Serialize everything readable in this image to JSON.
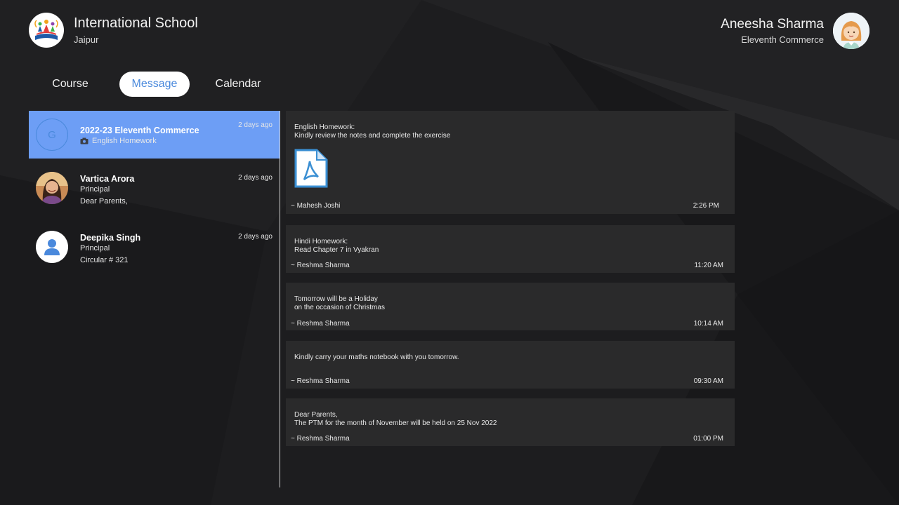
{
  "school": {
    "name": "International School",
    "city": "Jaipur",
    "logo_icon": "school-logo-icon"
  },
  "user": {
    "name": "Aneesha Sharma",
    "class": "Eleventh Commerce",
    "avatar_icon": "girl-avatar-icon"
  },
  "tabs": [
    {
      "label": "Course",
      "active": false
    },
    {
      "label": "Message",
      "active": true
    },
    {
      "label": "Calendar",
      "active": false
    }
  ],
  "conversations": [
    {
      "title": "2022-23 Eleventh Commerce",
      "line1": "English Homework",
      "line1_icon": "camera-icon",
      "time": "2 days ago",
      "avatar_letter": "G",
      "active": true
    },
    {
      "title": "Vartica Arora",
      "line1": "Principal",
      "line2": "Dear Parents,",
      "time": "2 days ago",
      "avatar_icon": "photo-avatar"
    },
    {
      "title": "Deepika Singh",
      "line1": "Principal",
      "line2": "Circular  # 321",
      "time": "2 days ago",
      "avatar_icon": "person-icon"
    }
  ],
  "messages": [
    {
      "text": "English Homework:\nKindly review the notes and complete the exercise",
      "attachment": "pdf-file-icon",
      "author": "~ Mahesh Joshi",
      "time": "2:26 PM"
    },
    {
      "text": "Hindi Homework:\nRead Chapter 7 in Vyakran",
      "author": "~ Reshma Sharma",
      "time": "11:20 AM"
    },
    {
      "text": "Tomorrow will be a Holiday\non the occasion of Christmas",
      "author": "~ Reshma Sharma",
      "time": "10:14 AM"
    },
    {
      "text": "Kindly carry your maths notebook with you tomorrow.",
      "author": "~ Reshma Sharma",
      "time": "09:30 AM"
    },
    {
      "text": "Dear Parents,\nThe PTM for the month of November will be held on 25 Nov 2022",
      "author": "~ Reshma Sharma",
      "time": "01:00 PM"
    }
  ],
  "colors": {
    "accent": "#4a89dc",
    "selected_row": "#6d9ef5",
    "panel": "#2a2a2b",
    "background": "#1c1c1e"
  }
}
